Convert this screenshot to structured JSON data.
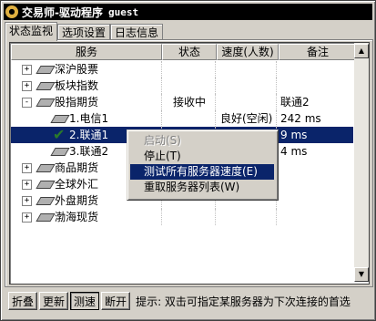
{
  "window": {
    "title": "交易师-驱动程序",
    "user": "guest"
  },
  "tabs": [
    "状态监视",
    "选项设置",
    "日志信息"
  ],
  "columns": [
    "服务",
    "状态",
    "速度(人数)",
    "备注"
  ],
  "rows": [
    {
      "label": "深沪股票",
      "level": 0,
      "expander": "+",
      "status": "",
      "speed": "",
      "note": ""
    },
    {
      "label": "板块指数",
      "level": 0,
      "expander": "+",
      "status": "",
      "speed": "",
      "note": ""
    },
    {
      "label": "股指期货",
      "level": 0,
      "expander": "-",
      "status": "接收中",
      "speed": "",
      "note": "联通2"
    },
    {
      "label": "1.电信1",
      "level": 1,
      "status": "",
      "speed": "良好(空闲)",
      "note": "242 ms"
    },
    {
      "label": "2.联通1",
      "level": 1,
      "status": "",
      "speed": "",
      "note": "9 ms",
      "selected": true,
      "checked": true
    },
    {
      "label": "3.联通2",
      "level": 1,
      "status": "",
      "speed": "",
      "note": "4 ms"
    },
    {
      "label": "商品期货",
      "level": 0,
      "expander": "+",
      "status": "",
      "speed": "",
      "note": ""
    },
    {
      "label": "全球外汇",
      "level": 0,
      "expander": "+",
      "status": "",
      "speed": "",
      "note": ""
    },
    {
      "label": "外盘期货",
      "level": 0,
      "expander": "+",
      "status": "",
      "speed": "",
      "note": ""
    },
    {
      "label": "渤海现货",
      "level": 0,
      "expander": "+",
      "status": "",
      "speed": "",
      "note": ""
    }
  ],
  "context_menu": [
    {
      "label": "启动(S)",
      "disabled": true
    },
    {
      "label": "停止(T)"
    },
    {
      "label": "测试所有服务器速度(E)",
      "highlight": true
    },
    {
      "label": "重取服务器列表(W)"
    }
  ],
  "buttons": {
    "collapse": "折叠",
    "update": "更新",
    "speedtest": "测速",
    "disconnect": "断开"
  },
  "hint": "提示: 双击可指定某服务器为下次连接的首选"
}
